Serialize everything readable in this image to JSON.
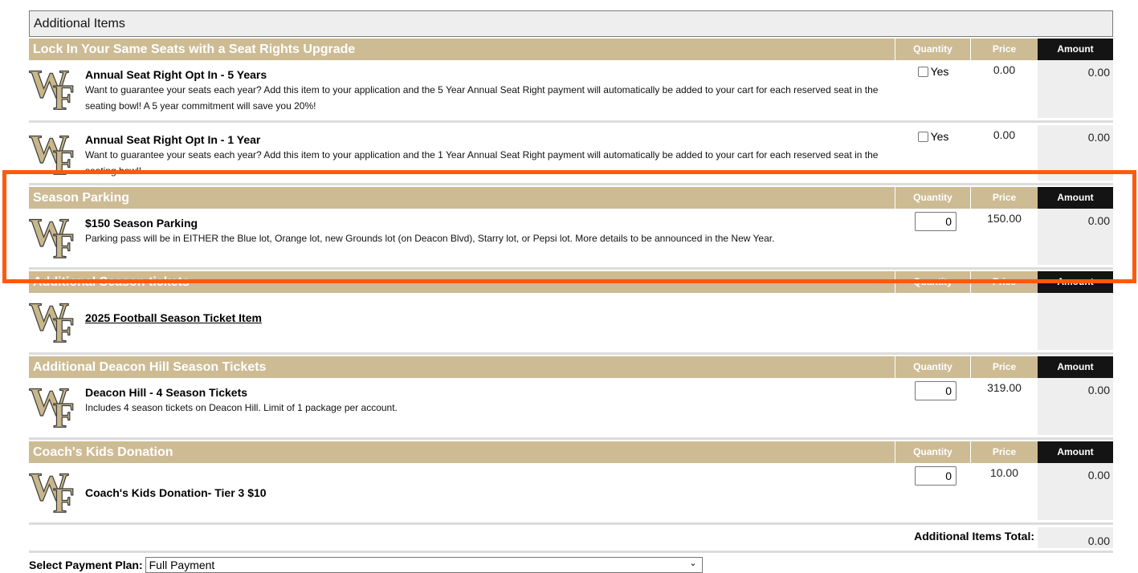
{
  "section_title": "Additional Items",
  "columns": {
    "quantity": "Quantity",
    "price": "Price",
    "amount": "Amount"
  },
  "logo": {
    "icon": "wf-logo-icon",
    "text": "WF",
    "colors": {
      "fill": "#c8b78a",
      "outline": "#3a3a3a"
    }
  },
  "groups": [
    {
      "title": "Lock In Your Same Seats with a Seat Rights Upgrade",
      "items": [
        {
          "name": "Annual Seat Right Opt In - 5 Years",
          "description": "Want to guarantee your seats each year? Add this item to your application and the 5 Year Annual Seat Right payment will automatically be added to your cart for each reserved seat in the seating bowl! A 5 year commitment will save you 20%!",
          "quantity_type": "checkbox",
          "checkbox_label": "Yes",
          "checked": false,
          "price": "0.00",
          "amount": "0.00"
        },
        {
          "name": "Annual Seat Right Opt In - 1 Year",
          "description": "Want to guarantee your seats each year? Add this item to your application and the 1 Year Annual Seat Right payment will automatically be added to your cart for each reserved seat in the seating bowl!",
          "quantity_type": "checkbox",
          "checkbox_label": "Yes",
          "checked": false,
          "price": "0.00",
          "amount": "0.00"
        }
      ]
    },
    {
      "title": "Season Parking",
      "items": [
        {
          "name": "$150 Season Parking",
          "description": "Parking pass will be in EITHER the Blue lot, Orange lot, new Grounds lot (on Deacon Blvd), Starry lot, or Pepsi lot. More details to be announced in the New Year.",
          "quantity_type": "input",
          "quantity": "0",
          "price": "150.00",
          "amount": "0.00"
        }
      ]
    },
    {
      "title": "Additional Season tickets",
      "items": [
        {
          "name": "2025 Football Season Ticket Item",
          "description": "",
          "quantity_type": "none",
          "price": "",
          "amount": ""
        }
      ]
    },
    {
      "title": "Additional Deacon Hill Season Tickets",
      "items": [
        {
          "name": "Deacon Hill - 4 Season Tickets",
          "description": "Includes 4 season tickets on Deacon Hill. Limit of 1 package per account.",
          "quantity_type": "input",
          "quantity": "0",
          "price": "319.00",
          "amount": "0.00"
        }
      ]
    },
    {
      "title": "Coach's Kids Donation",
      "items": [
        {
          "name": "Coach's Kids Donation- Tier 3 $10",
          "description": "",
          "quantity_type": "input",
          "quantity": "0",
          "price": "10.00",
          "amount": "0.00"
        }
      ]
    }
  ],
  "total": {
    "label": "Additional Items Total:",
    "value": "0.00"
  },
  "payment_plan": {
    "label": "Select Payment Plan:",
    "selected": "Full Payment"
  },
  "colors": {
    "header_gold": "#cdbb93",
    "amount_header": "#141414",
    "highlight": "#ff5a0a",
    "amount_bg": "#eeeeee"
  }
}
